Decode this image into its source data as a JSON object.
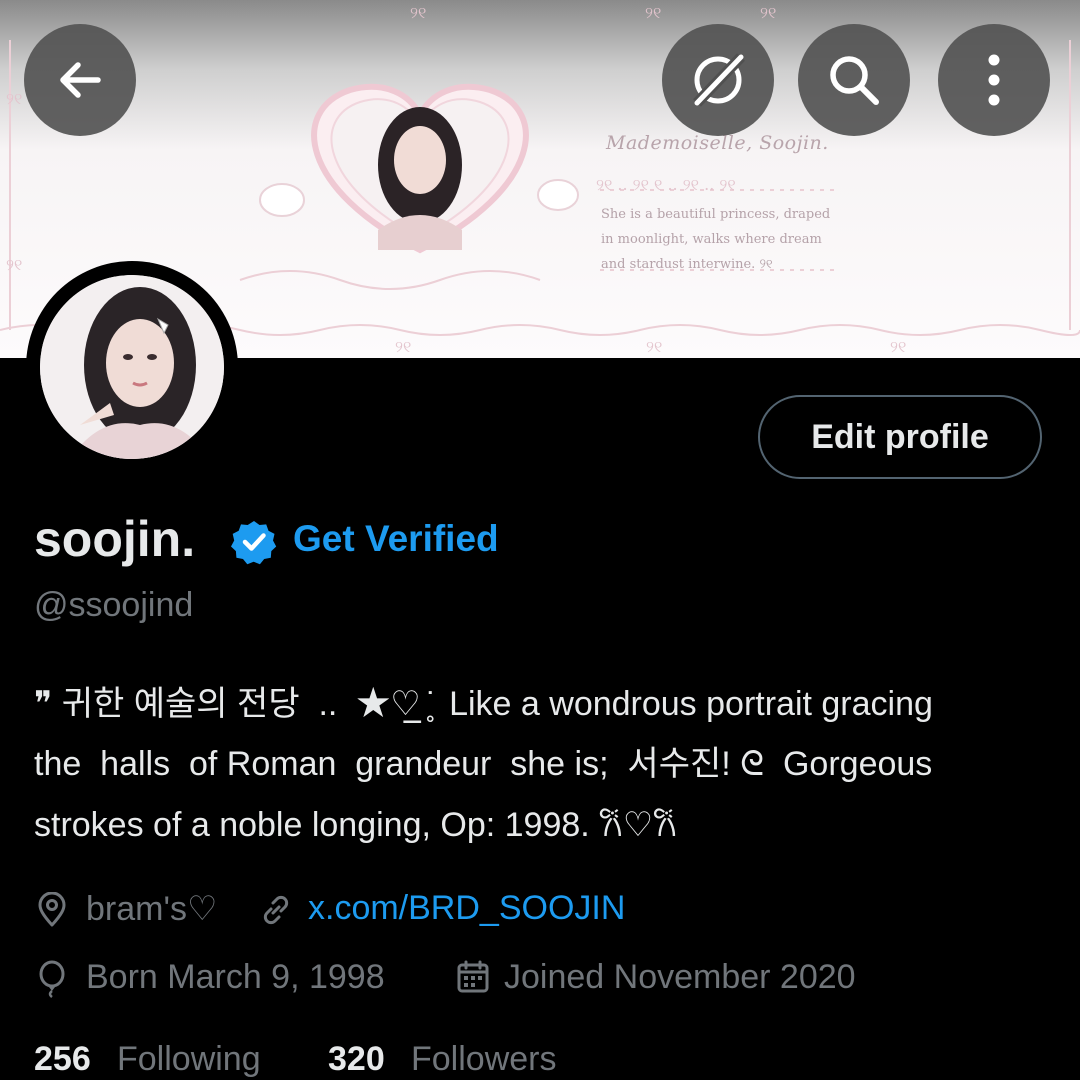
{
  "banner": {
    "title": "Mademoiselle, Soojin.",
    "poem": "She is a beautiful princess, draped\nin moonlight, walks where dream\nand stardust interwine.    ୨୧"
  },
  "nav": {
    "back_icon": "arrow-left-icon",
    "grok_icon": "grok-icon",
    "search_icon": "search-icon",
    "more_icon": "more-vertical-icon"
  },
  "profile": {
    "edit_label": "Edit profile",
    "display_name": "soojin.",
    "get_verified": "Get Verified",
    "handle": "@ssoojind",
    "bio_lines": [
      "❞ 귀한 예술의 전당  ..  ★♡̲ ̥̇  Like a wondrous portrait gracing",
      "the  halls  of Roman  grandeur  she is;  서수진! ᘓ  Gorgeous",
      "strokes of a noble longing, Op: 1998. 𐙚♡𐙚"
    ],
    "location": "bram's♡",
    "website": "x.com/BRD_SOOJIN",
    "birth": "Born March 9, 1998",
    "joined": "Joined November 2020",
    "following_count": "256",
    "following_label": "Following",
    "followers_count": "320",
    "followers_label": "Followers"
  },
  "colors": {
    "accent": "#1d9bf0",
    "text_primary": "#e7e9ea",
    "text_secondary": "#71767b",
    "background": "#000000",
    "border": "#536471"
  }
}
